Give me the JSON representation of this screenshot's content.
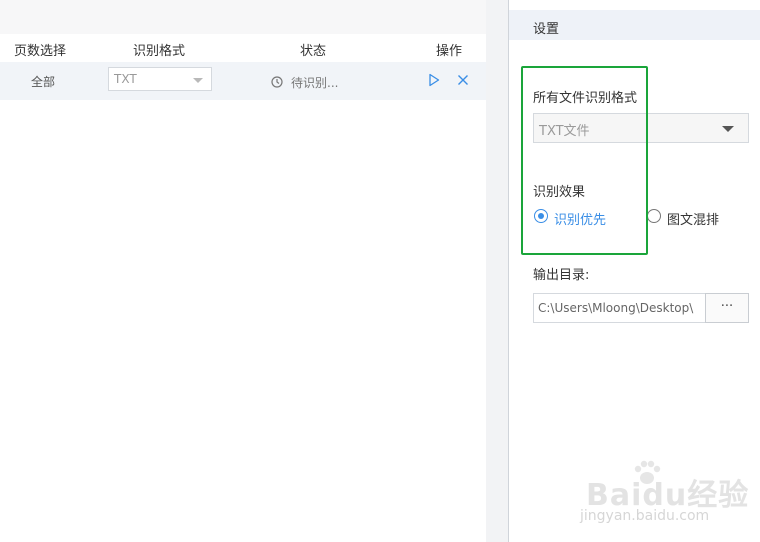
{
  "table": {
    "headers": [
      "页数选择",
      "识别格式",
      "状态",
      "操作"
    ],
    "rows": [
      {
        "pages": "全部",
        "format": "TXT",
        "status": "待识别..."
      }
    ]
  },
  "settings": {
    "title": "设置",
    "all_format_label": "所有文件识别格式",
    "all_format_value": "TXT文件",
    "effect_label": "识别效果",
    "radio_priority": "识别优先",
    "radio_mixed": "图文混排",
    "output_label": "输出目录:",
    "output_path": "C:\\Users\\Mloong\\Desktop\\",
    "browse_label": "···"
  },
  "watermark": {
    "brand": "Baidu经验",
    "url": "jingyan.baidu.com"
  },
  "colors": {
    "accent": "#3a8ee6",
    "highlight": "#1aa53a",
    "row_bg": "#f1f4f8",
    "header_bg": "#eef2f8"
  }
}
